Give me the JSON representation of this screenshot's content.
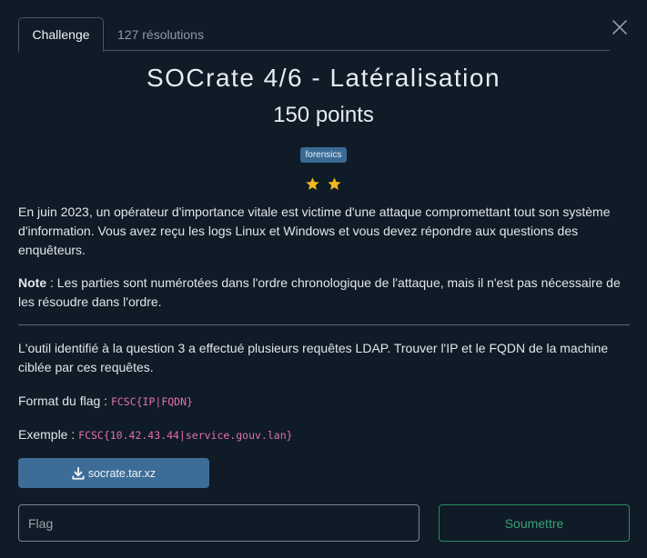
{
  "tabs": [
    {
      "label": "Challenge",
      "active": true
    },
    {
      "label": "127 résolutions",
      "active": false
    }
  ],
  "challenge": {
    "title": "SOCrate 4/6 - Latéralisation",
    "points": "150 points",
    "tag": "forensics",
    "difficulty_stars": 2,
    "description": "En juin 2023, un opérateur d'importance vitale est victime d'une attaque compromettant tout son système d'information. Vous avez reçu les logs Linux et Windows et vous devez répondre aux questions des enquêteurs.",
    "note_label": "Note",
    "note_text": " : Les parties sont numérotées dans l'ordre chronologique de l'attaque, mais il n'est pas nécessaire de les résoudre dans l'ordre.",
    "question": "L'outil identifié à la question 3 a effectué plusieurs requêtes LDAP. Trouver l'IP et le FQDN de la machine ciblée par ces requêtes.",
    "format_label": "Format du flag : ",
    "format_code": "FCSC{IP|FQDN}",
    "example_label": "Exemple : ",
    "example_code": "FCSC{10.42.43.44|service.gouv.lan}",
    "download_label": "socrate.tar.xz"
  },
  "form": {
    "flag_placeholder": "Flag",
    "flag_value": "",
    "submit_label": "Soumettre"
  },
  "icons": {
    "close": "close-icon",
    "star": "star-icon",
    "download": "download-icon"
  },
  "colors": {
    "background": "#0f1b26",
    "tag": "#3a6a94",
    "star": "#f0b81e",
    "code": "#e36fb0",
    "button": "#3d6d96",
    "submit": "#2e8a62"
  }
}
